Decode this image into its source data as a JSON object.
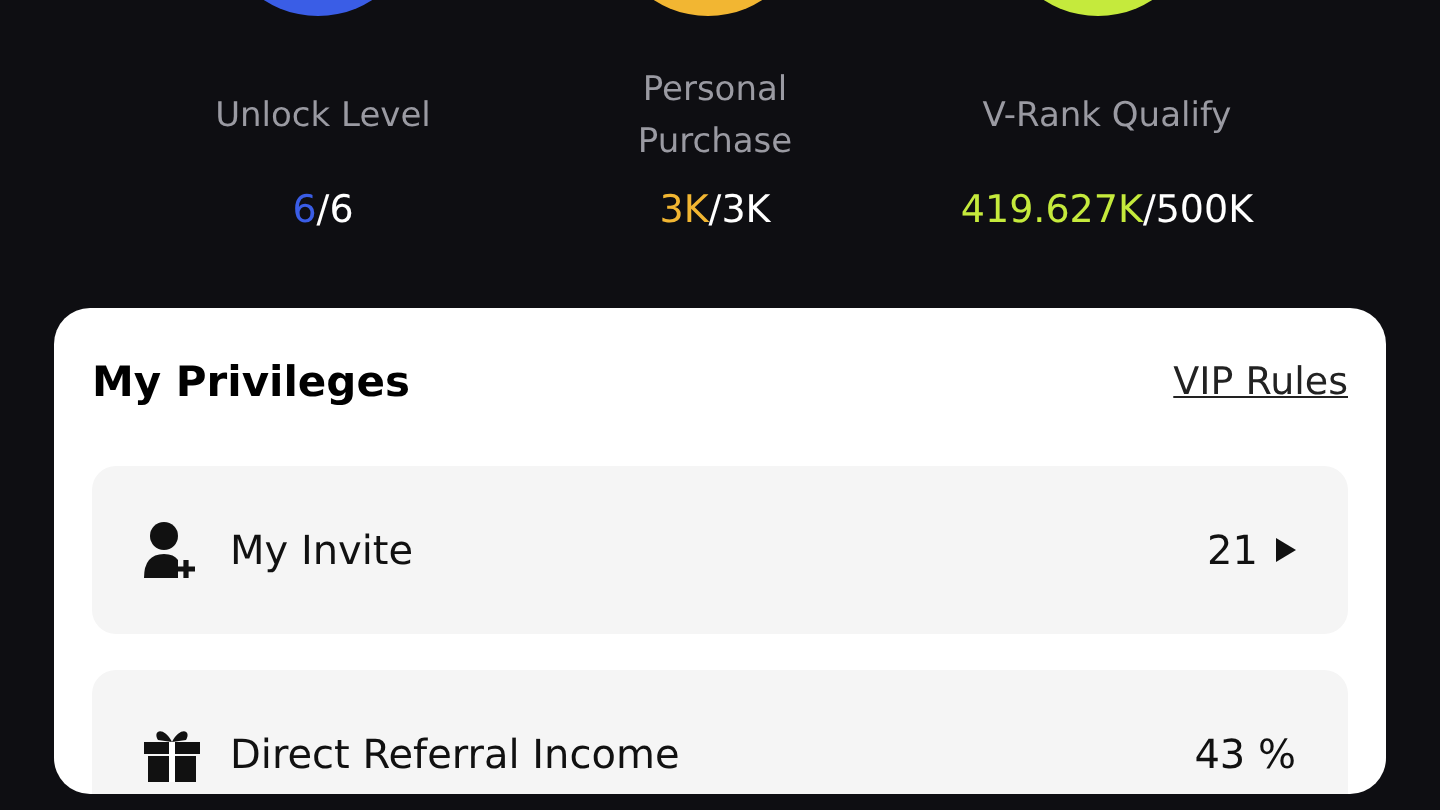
{
  "stats": [
    {
      "label": "Unlock Level",
      "current": "6",
      "total": "/6",
      "color": "#3a5de6"
    },
    {
      "label": "Personal Purchase",
      "current": "3K",
      "total": "/3K",
      "color": "#f2b632"
    },
    {
      "label": "V-Rank Qualify",
      "current": "419.627K",
      "total": "/500K",
      "color": "#c5ea3c"
    }
  ],
  "privileges": {
    "title": "My Privileges",
    "rules_link": "VIP Rules",
    "items": [
      {
        "kind": "link",
        "label": "My Invite",
        "value": "21"
      },
      {
        "kind": "value",
        "label": "Direct Referral Income",
        "value": "43 %"
      }
    ]
  }
}
